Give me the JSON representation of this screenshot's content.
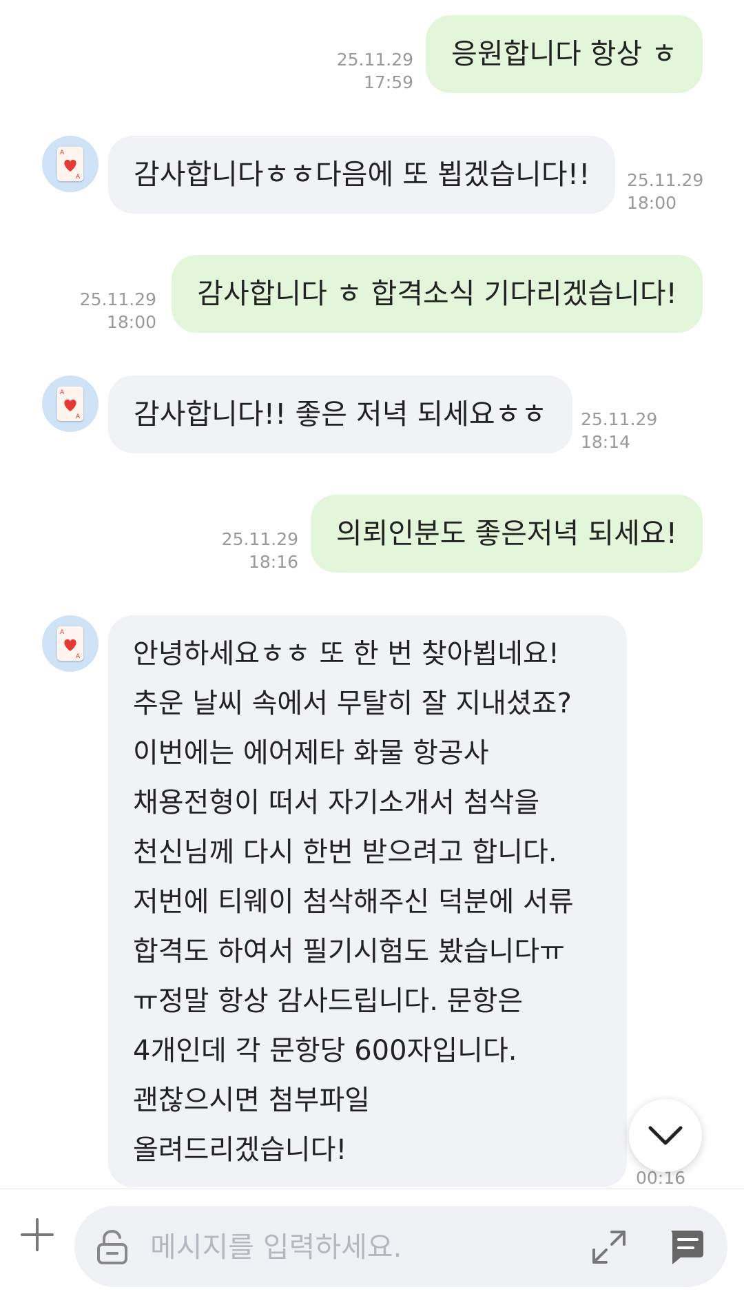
{
  "messages": [
    {
      "side": "out",
      "text": "응원합니다 항상 ㅎ",
      "date": "25.11.29",
      "time": "17:59"
    },
    {
      "side": "in",
      "text": "감사합니다ㅎㅎ다음에 또 뵙겠습니다!!",
      "date": "25.11.29",
      "time": "18:00"
    },
    {
      "side": "out",
      "text": "감사합니다 ㅎ 합격소식 기다리겠습니다!",
      "date": "25.11.29",
      "time": "18:00"
    },
    {
      "side": "in",
      "text": "감사합니다!! 좋은 저녁 되세요ㅎㅎ",
      "date": "25.11.29",
      "time": "18:14"
    },
    {
      "side": "out",
      "text": "의뢰인분도 좋은저녁 되세요!",
      "date": "25.11.29",
      "time": "18:16"
    }
  ],
  "last_message": {
    "lines": [
      "안녕하세요ㅎㅎ 또 한 번 찾아뵙네요!",
      "추운 날씨 속에서 무탈히 잘 지내셨죠?",
      "이번에는 에어제타 화물 항공사",
      "채용전형이 떠서 자기소개서 첨삭을",
      "천신님께 다시 한번 받으려고 합니다.",
      "저번에 티웨이 첨삭해주신 덕분에 서류",
      "합격도 하여서 필기시험도 봤습니다ㅠ",
      "ㅠ정말 항상 감사드립니다. 문항은",
      "4개인데 각 문항당 600자입니다.",
      "괜찮으시면 첨부파일",
      "올려드리겠습니다!"
    ],
    "time": "00:16"
  },
  "composer": {
    "placeholder": "메시지를 입력하세요."
  },
  "icons": {
    "plus": "plus-icon",
    "lock": "unlock-icon",
    "expand": "expand-icon",
    "send": "chat-bubble-icon",
    "scroll": "chevron-down-icon",
    "avatar": "heart-card-icon"
  },
  "colors": {
    "outgoing_bubble": "#e3f6da",
    "incoming_bubble": "#f1f2f6",
    "avatar_bg": "#cfe3f6",
    "timestamp": "#999999"
  }
}
